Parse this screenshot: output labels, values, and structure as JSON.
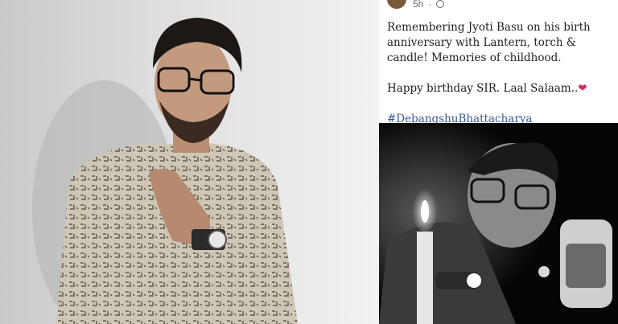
{
  "post": {
    "time": "5h",
    "line1": "Remembering Jyoti Basu on his birth anniversary with Lantern, torch & candle! Memories of childhood.",
    "line2": "Happy birthday SIR. Laal Salaam..",
    "heart": "❤",
    "hashtag": "#DebangshuBhattacharya"
  },
  "colors": {
    "link": "#385898",
    "heart": "#e0245e",
    "meta": "#65676b"
  }
}
